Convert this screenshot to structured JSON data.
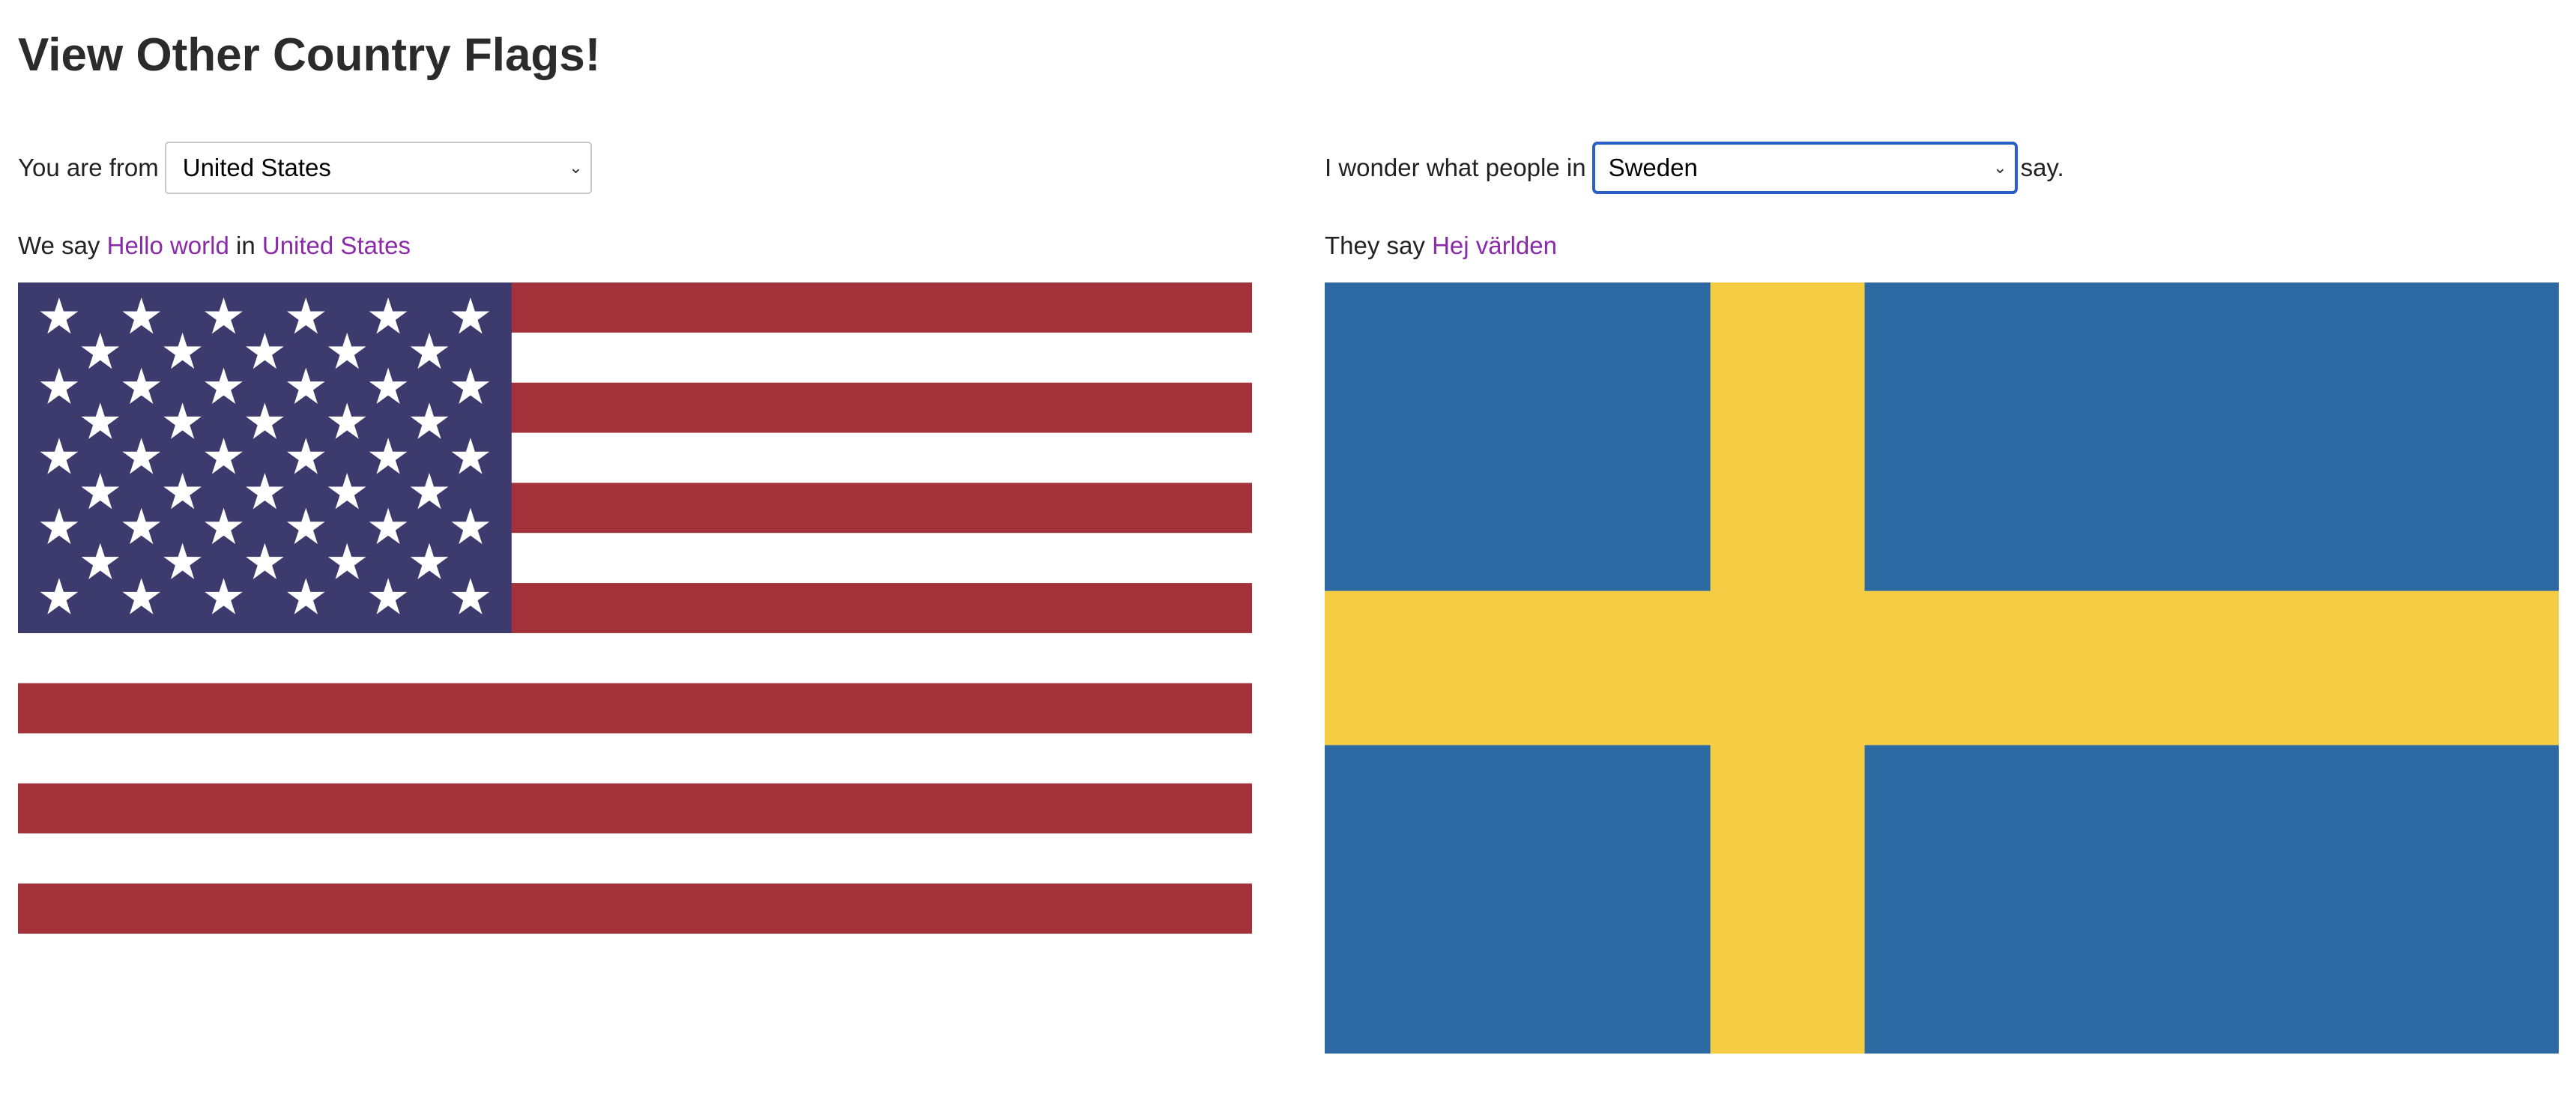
{
  "title": "View Other Country Flags!",
  "left": {
    "label": "You are from",
    "selected_country": "United States",
    "we_say": "We say",
    "greeting": "Hello world",
    "in": "in",
    "country_link": "United States"
  },
  "right": {
    "label": "I wonder what people in",
    "selected_country": "Sweden",
    "suffix": "say.",
    "they_say": "They say",
    "greeting": "Hej världen"
  },
  "colors": {
    "us_red": "#a3313a",
    "us_blue": "#3d3b6d",
    "se_blue": "#2d6aa3",
    "se_yellow": "#f5cd45",
    "link": "#8b2aa8",
    "focus": "#2a5fc9"
  }
}
